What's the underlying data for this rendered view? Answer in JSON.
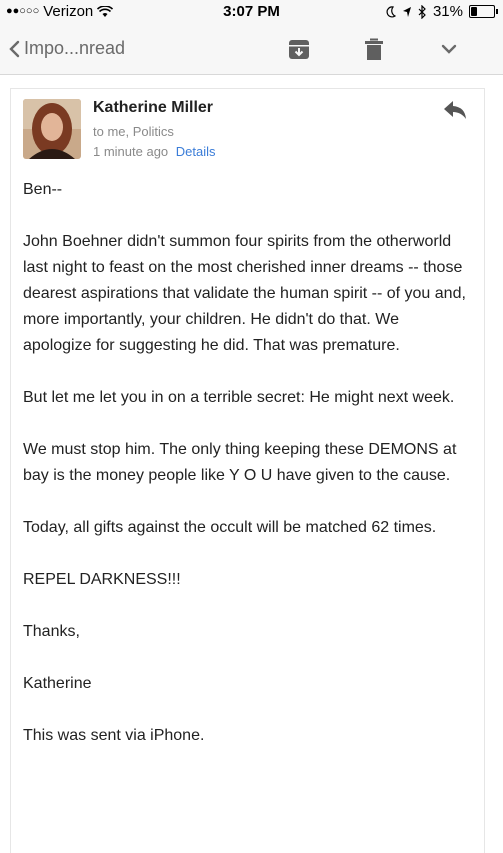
{
  "status_bar": {
    "carrier": "Verizon",
    "time": "3:07 PM",
    "battery": "31%",
    "battery_level": 0.31
  },
  "nav": {
    "back_label": "Impo...nread"
  },
  "email": {
    "sender": "Katherine Miller",
    "recipients": "to me, Politics",
    "time_ago": "1 minute ago",
    "details_label": "Details",
    "paragraphs": [
      "Ben--",
      "John Boehner didn't summon four spirits from the otherworld last night to feast on the most cherished inner dreams -- those dearest aspirations that validate the human spirit -- of you and, more importantly, your children. He didn't do that. We apologize for suggesting he did. That was premature.",
      "But let me let you in on a terrible secret: He might next week.",
      "We must stop him. The only thing keeping these DEMONS at bay is the money people like Y O U have given to the cause.",
      "Today, all gifts against the occult will be matched 62 times.",
      "REPEL DARKNESS!!!",
      "Thanks,",
      "Katherine",
      "This was sent via iPhone."
    ]
  },
  "icons": {
    "signal": "signal-dots-icon",
    "wifi": "wifi-icon",
    "moon": "moon-icon",
    "location": "location-arrow-icon",
    "bluetooth": "bluetooth-icon",
    "back": "chevron-left-icon",
    "archive": "archive-icon",
    "trash": "trash-icon",
    "more": "chevron-down-icon",
    "reply": "reply-icon"
  },
  "colors": {
    "link": "#3b7dd8",
    "muted": "#8a8a8a",
    "icon": "#6a6a6a"
  }
}
